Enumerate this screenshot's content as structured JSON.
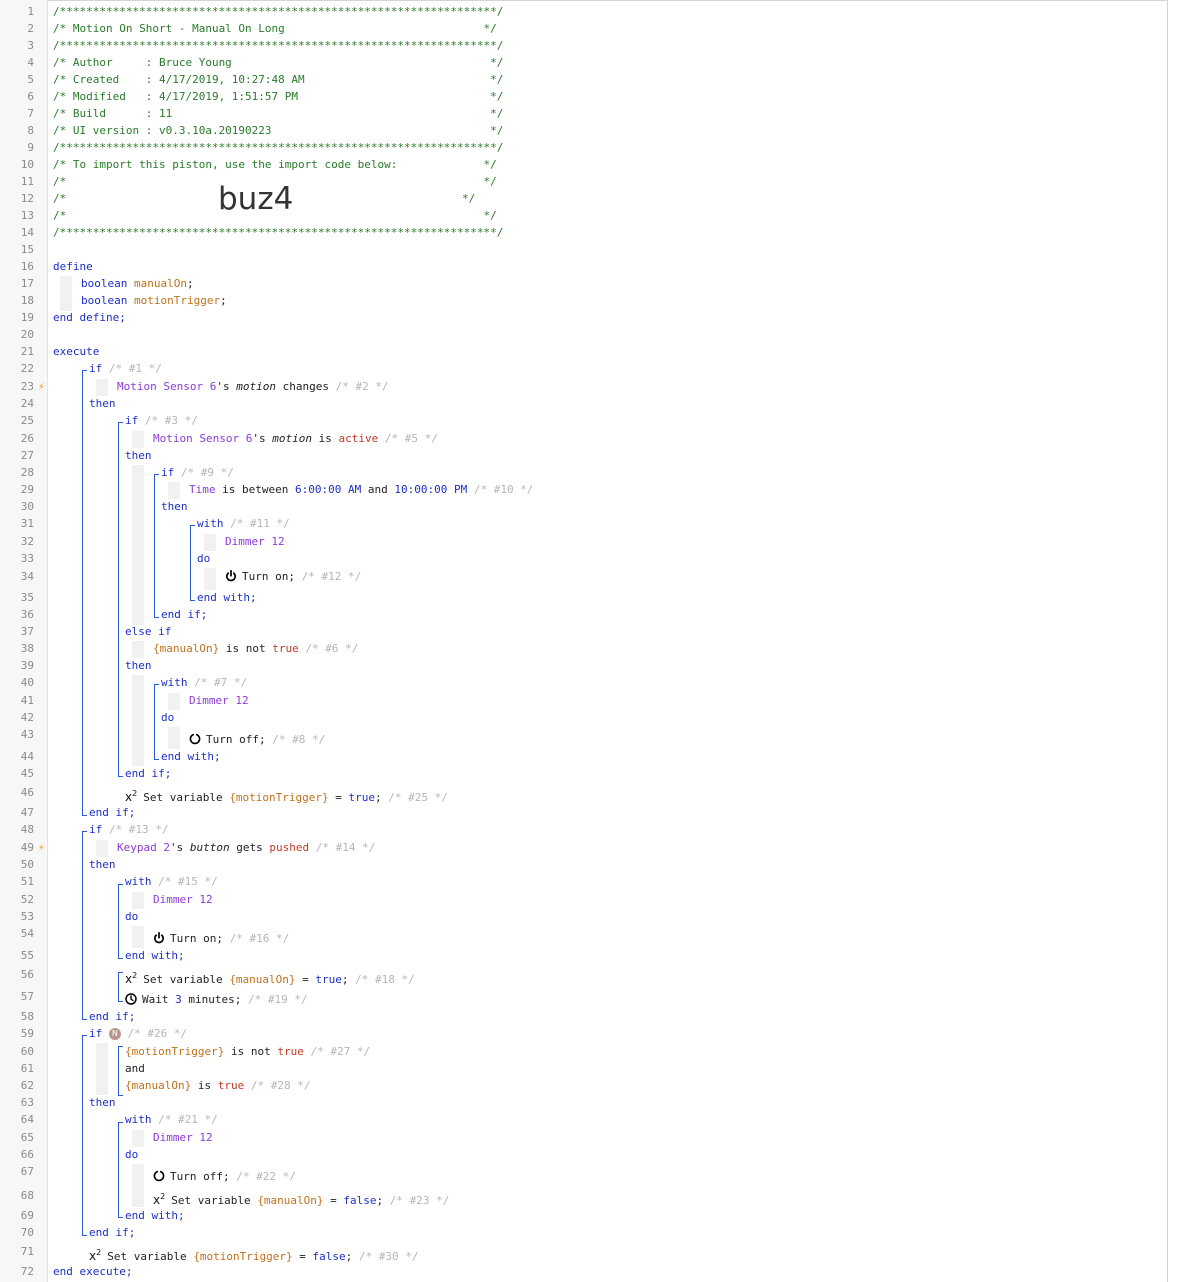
{
  "header": {
    "line1": "/******************************************************************/",
    "line2": "/* Motion On Short - Manual On Long                              */",
    "line3": "/******************************************************************/",
    "line4": "/* Author     : Bruce Young                                       */",
    "line5": "/* Created    : 4/17/2019, 10:27:48 AM                            */",
    "line6": "/* Modified   : 4/17/2019, 1:51:57 PM                             */",
    "line7": "/* Build      : 11                                                */",
    "line8": "/* UI version : v0.3.10a.20190223                                 */",
    "line9": "/******************************************************************/",
    "line10": "/* To import this piston, use the import code below:             */",
    "line11": "/*                                                               */",
    "line12_pre": "/*",
    "import_code": "buz4",
    "line12_post": "*/",
    "line13": "/*                                                               */",
    "line14": "/******************************************************************/"
  },
  "line_numbers": [
    "1",
    "2",
    "3",
    "4",
    "5",
    "6",
    "7",
    "8",
    "9",
    "10",
    "11",
    "12",
    "13",
    "14",
    "15",
    "16",
    "17",
    "18",
    "19",
    "20",
    "21",
    "22",
    "23",
    "24",
    "25",
    "26",
    "27",
    "28",
    "29",
    "30",
    "31",
    "32",
    "33",
    "34",
    "35",
    "36",
    "37",
    "38",
    "39",
    "40",
    "41",
    "42",
    "43",
    "44",
    "45",
    "46",
    "47",
    "48",
    "49",
    "50",
    "51",
    "52",
    "53",
    "54",
    "55",
    "56",
    "57",
    "58",
    "59",
    "60",
    "61",
    "62",
    "63",
    "64",
    "65",
    "66",
    "67",
    "68",
    "69",
    "70",
    "71",
    "72"
  ],
  "code": {
    "define": "define",
    "type_boolean": "boolean",
    "var_manualOn": "manualOn",
    "var_motionTrigger": "motionTrigger",
    "semicolon": ";",
    "end_define": "end define;",
    "execute": "execute",
    "end_execute": "end execute;",
    "if": "if",
    "then": "then",
    "else_if": "else if",
    "end_if": "end if;",
    "with": "with",
    "do": "do",
    "end_with": "end with;",
    "and": "and",
    "c1": "/* #1 */",
    "c2": "/* #2 */",
    "c3": "/* #3 */",
    "c5": "/* #5 */",
    "c6": "/* #6 */",
    "c7": "/* #7 */",
    "c8": "/* #8 */",
    "c9": "/* #9 */",
    "c10": "/* #10 */",
    "c11": "/* #11 */",
    "c12": "/* #12 */",
    "c13": "/* #13 */",
    "c14": "/* #14 */",
    "c15": "/* #15 */",
    "c16": "/* #16 */",
    "c18": "/* #18 */",
    "c19": "/* #19 */",
    "c21": "/* #21 */",
    "c22": "/* #22 */",
    "c23": "/* #23 */",
    "c25": "/* #25 */",
    "c26": "/* #26 */",
    "c27": "/* #27 */",
    "c28": "/* #28 */",
    "c30": "/* #30 */",
    "motion_sensor": "Motion Sensor 6",
    "apos_s": "'s",
    "motion": "motion",
    "changes": "changes",
    "is": "is",
    "active": "active",
    "time": "Time",
    "is_between": "is between",
    "t_start": "6:00:00 AM",
    "t_end": "10:00:00 PM",
    "dimmer": "Dimmer 12",
    "turn_on": "Turn on;",
    "turn_off": "Turn off;",
    "manualOn_ref": "{manualOn}",
    "motionTrigger_ref": "{motionTrigger}",
    "is_not": "is not",
    "true": "true",
    "false": "false",
    "set_variable": "Set variable",
    "eq": "=",
    "keypad": "Keypad 2",
    "button": "button",
    "gets": "gets",
    "pushed": "pushed",
    "wait": "Wait",
    "wait_num": "3",
    "minutes": "minutes;",
    "badge": "N",
    "x": "x",
    "sup2": "2"
  },
  "icons": {
    "trigger": "lightning-bolt-icon",
    "power_on": "power-on-icon",
    "power_off": "power-off-icon",
    "variable": "x-squared-icon",
    "wait": "clock-icon"
  },
  "colors": {
    "keyword": "#1d2fc7",
    "device": "#8c3bd6",
    "variable": "#c0711a",
    "value": "#c0392b",
    "comment": "#b5b5b5",
    "header": "#2a7a2a",
    "block_line": "#2a5bd7",
    "trigger": "#f39a2b"
  }
}
